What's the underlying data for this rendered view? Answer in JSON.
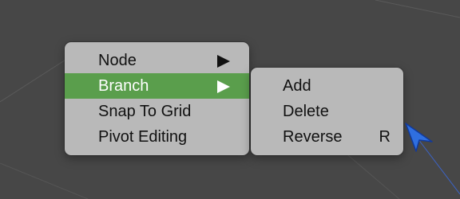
{
  "context_menu": {
    "items": [
      {
        "label": "Node",
        "has_submenu": true
      },
      {
        "label": "Branch",
        "has_submenu": true,
        "active": true
      },
      {
        "label": "Snap To Grid"
      },
      {
        "label": "Pivot Editing"
      }
    ]
  },
  "submenu": {
    "items": [
      {
        "label": "Add"
      },
      {
        "label": "Delete"
      },
      {
        "label": "Reverse",
        "shortcut": "R"
      }
    ]
  },
  "colors": {
    "background": "#474747",
    "menu_bg": "#b9b9b9",
    "highlight": "#5a9e4c",
    "cursor": "#2f6fe0"
  },
  "icons": {
    "submenu_arrow": "triangle-right-icon",
    "pointer": "arrow-cursor-icon"
  }
}
